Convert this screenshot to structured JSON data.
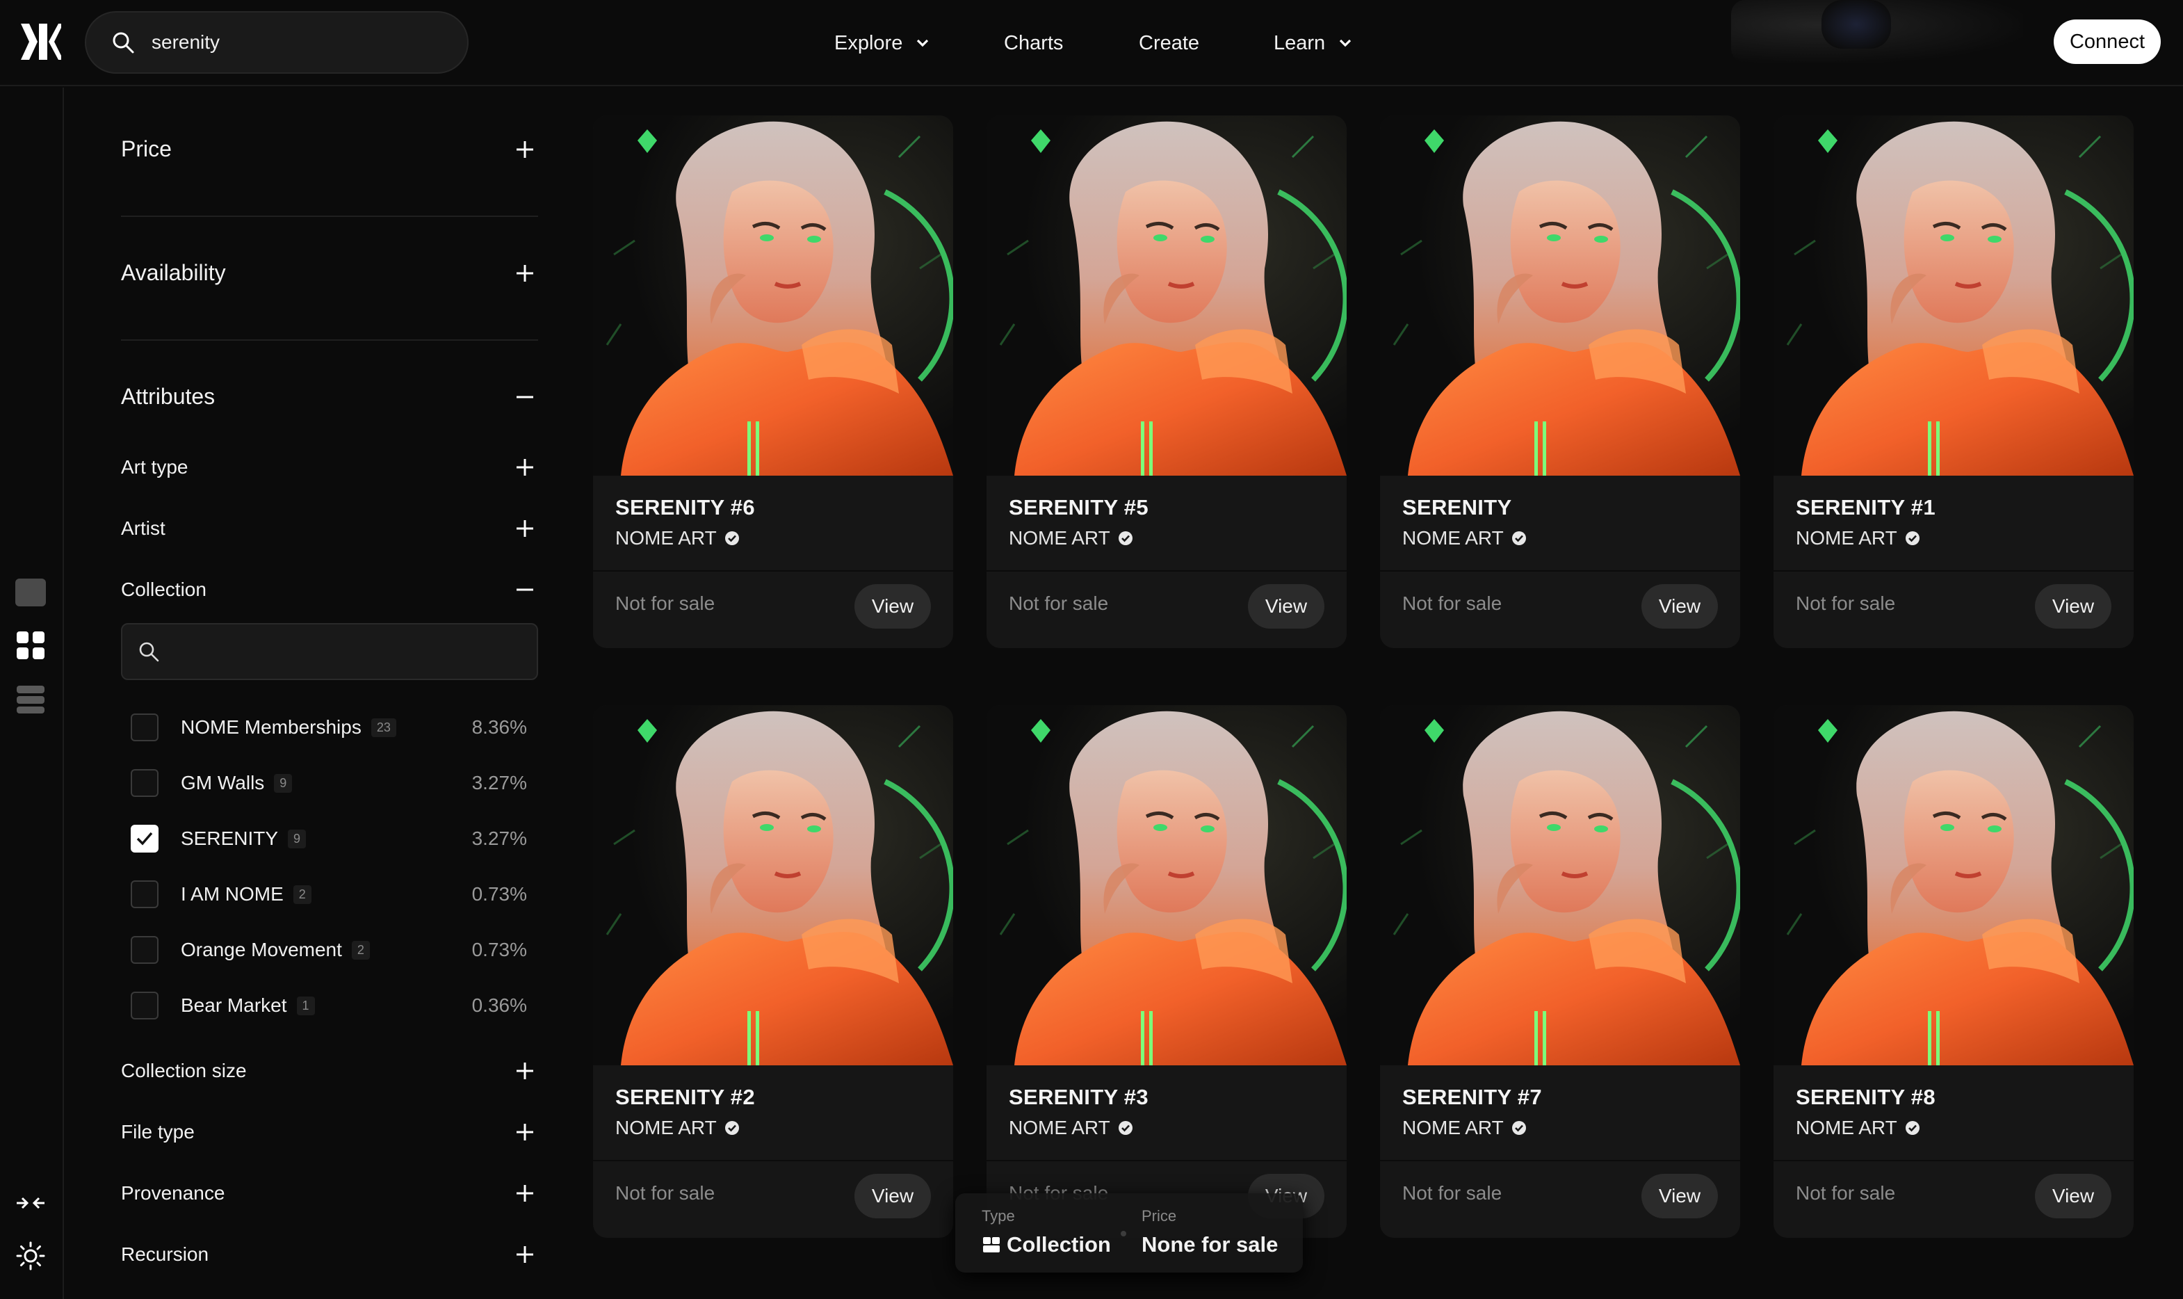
{
  "header": {
    "search_value": "serenity",
    "nav": [
      "Explore",
      "Charts",
      "Create",
      "Learn"
    ],
    "connect_label": "Connect"
  },
  "filters": {
    "price": "Price",
    "availability": "Availability",
    "attributes": "Attributes",
    "art_type": "Art type",
    "artist": "Artist",
    "collection": "Collection",
    "collections": [
      {
        "name": "NOME Memberships",
        "count": "23",
        "pct": "8.36%",
        "checked": false
      },
      {
        "name": "GM Walls",
        "count": "9",
        "pct": "3.27%",
        "checked": false
      },
      {
        "name": "SERENITY",
        "count": "9",
        "pct": "3.27%",
        "checked": true
      },
      {
        "name": "I AM NOME",
        "count": "2",
        "pct": "0.73%",
        "checked": false
      },
      {
        "name": "Orange Movement",
        "count": "2",
        "pct": "0.73%",
        "checked": false
      },
      {
        "name": "Bear Market",
        "count": "1",
        "pct": "0.36%",
        "checked": false
      }
    ],
    "collection_size": "Collection size",
    "file_type": "File type",
    "provenance": "Provenance",
    "recursion": "Recursion"
  },
  "cards": [
    {
      "title": "SERENITY #6",
      "artist": "NOME ART",
      "status": "Not for sale",
      "action": "View"
    },
    {
      "title": "SERENITY #5",
      "artist": "NOME ART",
      "status": "Not for sale",
      "action": "View"
    },
    {
      "title": "SERENITY",
      "artist": "NOME ART",
      "status": "Not for sale",
      "action": "View"
    },
    {
      "title": "SERENITY #1",
      "artist": "NOME ART",
      "status": "Not for sale",
      "action": "View"
    },
    {
      "title": "SERENITY #2",
      "artist": "NOME ART",
      "status": "Not for sale",
      "action": "View"
    },
    {
      "title": "SERENITY #3",
      "artist": "NOME ART",
      "status": "Not for sale",
      "action": "View"
    },
    {
      "title": "SERENITY #7",
      "artist": "NOME ART",
      "status": "Not for sale",
      "action": "View"
    },
    {
      "title": "SERENITY #8",
      "artist": "NOME ART",
      "status": "Not for sale",
      "action": "View"
    }
  ],
  "info_bar": {
    "type_label": "Type",
    "type_value": "Collection",
    "price_label": "Price",
    "price_value": "None for sale"
  },
  "colors": {
    "background": "#0b0b0b",
    "card": "#161616",
    "accent_orange": "#f2612a",
    "accent_green": "#3fd86a"
  }
}
